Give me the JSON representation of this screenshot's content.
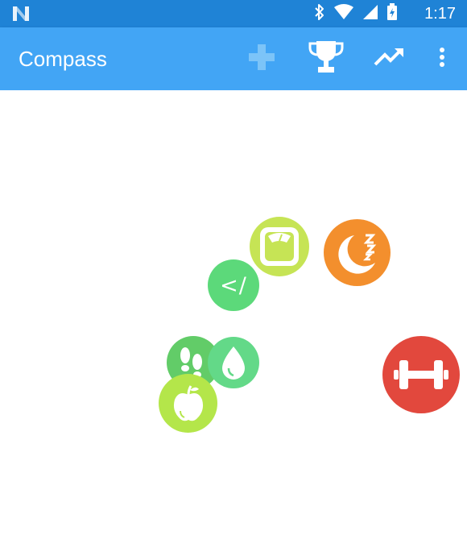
{
  "status_bar": {
    "time": "1:17",
    "icons": [
      "n-logo-icon",
      "bluetooth-icon",
      "wifi-icon",
      "cell-signal-icon",
      "battery-charging-icon"
    ],
    "background": "#1f83d6"
  },
  "app_bar": {
    "title": "Compass",
    "background": "#42a5f5",
    "actions": [
      "add-icon",
      "trophy-icon",
      "trending-up-icon",
      "overflow-menu-icon"
    ]
  },
  "bubbles": [
    {
      "name": "weight-scale-bubble",
      "icon": "scale-icon",
      "color": "#c6e455"
    },
    {
      "name": "sleep-bubble",
      "icon": "moon-zzz-icon",
      "color": "#f38f2d"
    },
    {
      "name": "code-bubble",
      "icon": "code-icon",
      "label": "</",
      "color": "#5cd97a"
    },
    {
      "name": "steps-bubble",
      "icon": "footsteps-icon",
      "color": "#62cc68"
    },
    {
      "name": "water-bubble",
      "icon": "water-drop-icon",
      "color": "#63d988"
    },
    {
      "name": "nutrition-bubble",
      "icon": "apple-icon",
      "color": "#b4e64a"
    },
    {
      "name": "fitness-bubble",
      "icon": "dumbbell-icon",
      "color": "#e2483d"
    }
  ]
}
